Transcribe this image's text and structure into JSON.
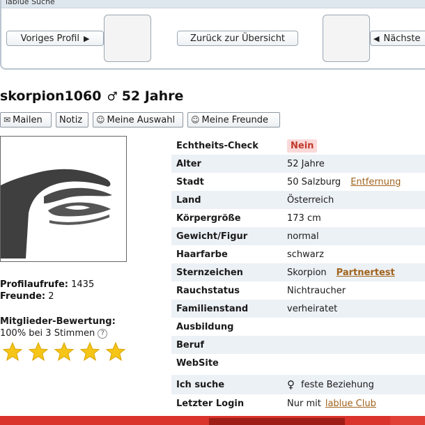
{
  "search_nav": {
    "title": "lablue Suche",
    "prev_profile": "Voriges Profil",
    "overview": "Zurück zur Übersicht",
    "next": "Nächste"
  },
  "profile": {
    "username": "skorpion1060",
    "gender_symbol": "♂",
    "age_label": "52 Jahre"
  },
  "actions": [
    {
      "label": "Mailen",
      "icon": "envelope-icon",
      "glyph": "✉"
    },
    {
      "label": "Notiz",
      "icon": "",
      "glyph": ""
    },
    {
      "label": "Meine Auswahl",
      "icon": "person-icon",
      "glyph": "☺"
    },
    {
      "label": "Meine Freunde",
      "icon": "person-icon",
      "glyph": "☺"
    }
  ],
  "stats": {
    "views_label": "Profilaufrufe:",
    "views_value": "1435",
    "friends_label": "Freunde:",
    "friends_value": "2",
    "rating_title": "Mitglieder-Bewertung:",
    "rating_text": "100% bei 3 Stimmen",
    "help_glyph": "?",
    "stars": 5
  },
  "details": {
    "echtheit_label": "Echtheits-Check",
    "echtheit_value": "Nein",
    "alter_label": "Alter",
    "alter_value": "52 Jahre",
    "stadt_label": "Stadt",
    "stadt_value": "50 Salzburg",
    "stadt_link": "Entfernung",
    "land_label": "Land",
    "land_value": "Österreich",
    "groesse_label": "Körpergröße",
    "groesse_value": "173 cm",
    "gewicht_label": "Gewicht/Figur",
    "gewicht_value": "normal",
    "haar_label": "Haarfarbe",
    "haar_value": "schwarz",
    "stern_label": "Sternzeichen",
    "stern_value": "Skorpion",
    "stern_link": "Partnertest",
    "rauch_label": "Rauchstatus",
    "rauch_value": "Nichtraucher",
    "familie_label": "Familienstand",
    "familie_value": "verheiratet",
    "ausbildung_label": "Ausbildung",
    "beruf_label": "Beruf",
    "website_label": "WebSite",
    "suche_label": "Ich suche",
    "suche_symbol": "♀",
    "suche_value": "feste Beziehung",
    "login_label": "Letzter Login",
    "login_value": "Nur mit",
    "login_link": "lablue Club"
  },
  "colors": {
    "accent_orange": "#a0621c",
    "badge_red": "#c0392b",
    "row_alt": "#ecf1f6",
    "footer_red": "#d9332b",
    "star_yellow": "#f5c518"
  }
}
